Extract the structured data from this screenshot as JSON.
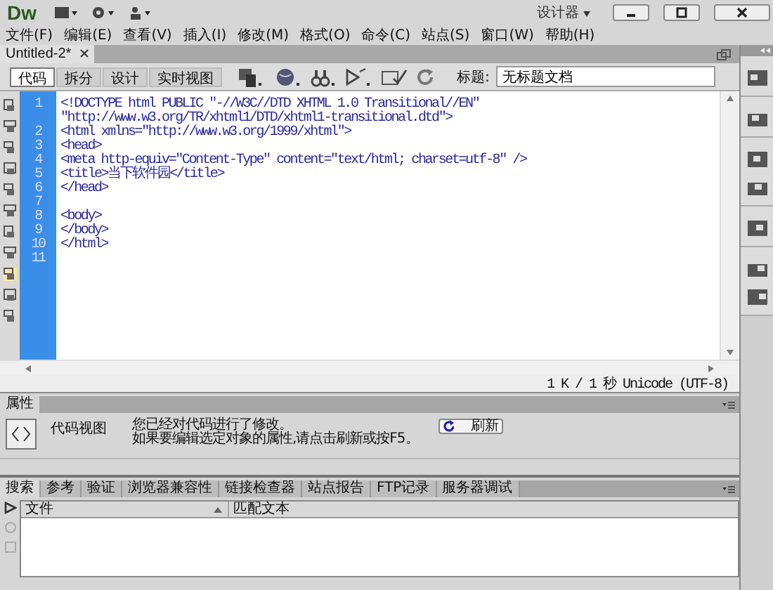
{
  "app_bar": {
    "logo": "Dw",
    "workspace": "设计器"
  },
  "menu": [
    "文件(F)",
    "编辑(E)",
    "查看(V)",
    "插入(I)",
    "修改(M)",
    "格式(O)",
    "命令(C)",
    "站点(S)",
    "窗口(W)",
    "帮助(H)"
  ],
  "document_tab": {
    "title": "Untitled-2*"
  },
  "view_buttons": [
    {
      "label": "代码",
      "selected": true
    },
    {
      "label": "拆分",
      "selected": false
    },
    {
      "label": "设计",
      "selected": false
    },
    {
      "label": "实时视图",
      "selected": false
    }
  ],
  "title_field": {
    "label": "标题:",
    "value": "无标题文档"
  },
  "code_lines": [
    {
      "number": "1",
      "rows": [
        "<!DOCTYPE html PUBLIC \"-//W3C//DTD XHTML 1.0 Transitional//EN\"",
        "\"http://www.w3.org/TR/xhtml1/DTD/xhtml1-transitional.dtd\">"
      ]
    },
    {
      "number": "2",
      "rows": [
        "<html xmlns=\"http://www.w3.org/1999/xhtml\">"
      ]
    },
    {
      "number": "3",
      "rows": [
        "<head>"
      ]
    },
    {
      "number": "4",
      "rows": [
        "<meta http-equiv=\"Content-Type\" content=\"text/html; charset=utf-8\" />"
      ]
    },
    {
      "number": "5",
      "rows": [
        "<title>当下软件园</title>"
      ]
    },
    {
      "number": "6",
      "rows": [
        "</head>"
      ]
    },
    {
      "number": "7",
      "rows": [
        ""
      ]
    },
    {
      "number": "8",
      "rows": [
        "<body>"
      ]
    },
    {
      "number": "9",
      "rows": [
        "</body>"
      ]
    },
    {
      "number": "10",
      "rows": [
        "</html>"
      ]
    },
    {
      "number": "11",
      "rows": [
        ""
      ]
    }
  ],
  "status_bar": "1 K / 1 秒 Unicode (UTF-8)",
  "properties": {
    "tab": "属性",
    "view_label": "代码视图",
    "message": [
      "您已经对代码进行了修改。",
      "如果要编辑选定对象的属性,请点击刷新或按F5。"
    ],
    "refresh_button": "刷新"
  },
  "results": {
    "tabs": [
      {
        "label": "搜索",
        "selected": true
      },
      {
        "label": "参考",
        "selected": false
      },
      {
        "label": "验证",
        "selected": false
      },
      {
        "label": "浏览器兼容性",
        "selected": false
      },
      {
        "label": "链接检查器",
        "selected": false
      },
      {
        "label": "站点报告",
        "selected": false
      },
      {
        "label": "FTP记录",
        "selected": false
      },
      {
        "label": "服务器调试",
        "selected": false
      }
    ],
    "columns": [
      "文件",
      "匹配文本"
    ]
  }
}
